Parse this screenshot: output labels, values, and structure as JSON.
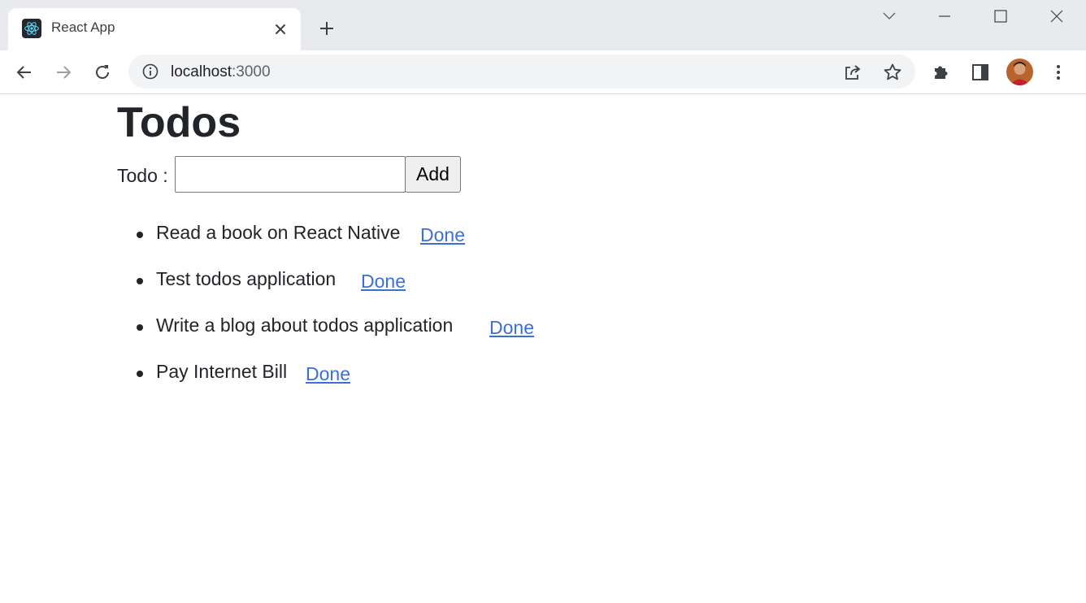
{
  "browser": {
    "tab": {
      "title": "React App",
      "favicon": "react-logo-icon"
    },
    "address": {
      "host": "localhost",
      "port": ":3000"
    },
    "icons": {
      "tab_close": "close-icon",
      "new_tab": "plus-icon",
      "tab_search": "chevron-down-icon",
      "minimize": "minimize-icon",
      "maximize": "maximize-icon",
      "close_window": "close-icon",
      "back": "arrow-left-icon",
      "forward": "arrow-right-icon",
      "reload": "reload-icon",
      "site_info": "info-icon",
      "share": "share-icon",
      "bookmark": "star-icon",
      "extensions": "puzzle-icon",
      "side_panel": "side-panel-icon",
      "menu": "kebab-menu-icon"
    },
    "colors": {
      "chrome_bg": "#e8eaed",
      "omnibox_bg": "#f1f3f4",
      "react_accent": "#61dafb"
    }
  },
  "page": {
    "title": "Todos",
    "form": {
      "label": "Todo :",
      "input_value": "",
      "add_button": "Add"
    },
    "todos": [
      {
        "text": "Read a book on React Native",
        "action": "Done"
      },
      {
        "text": "Test todos application",
        "action": "Done"
      },
      {
        "text": "Write a blog about todos application",
        "action": "Done"
      },
      {
        "text": "Pay Internet Bill",
        "action": "Done"
      }
    ],
    "colors": {
      "text": "#212529",
      "link": "#3a6fd8"
    }
  }
}
